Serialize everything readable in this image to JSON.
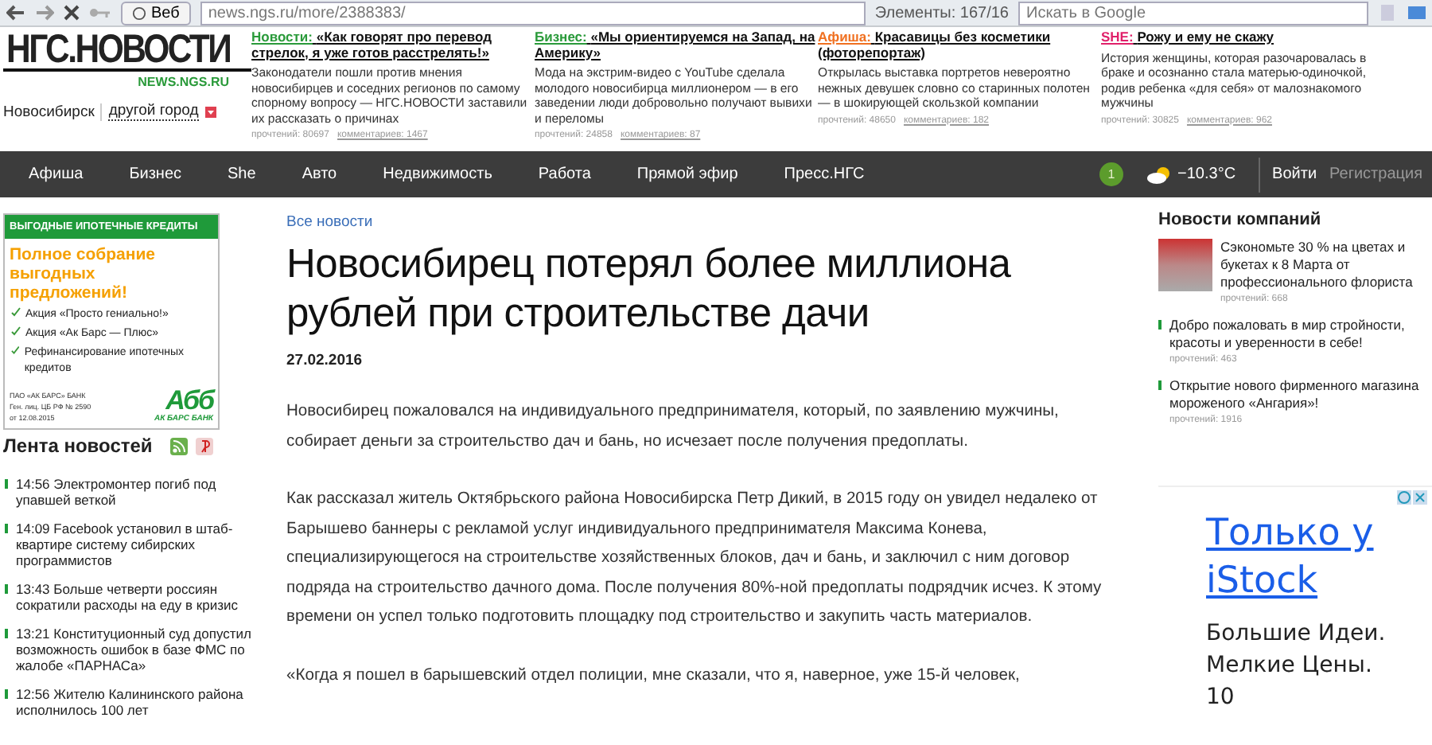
{
  "browser": {
    "tab_label": "Веб",
    "url": "news.ngs.ru/more/2388383/",
    "elements": "Элементы:  167/16",
    "search": {
      "placeholder": "Искать в Google"
    }
  },
  "header": {
    "logo": "НГС.НОВОСТИ",
    "domain": "NEWS.NGS.RU",
    "city": "Новосибирск",
    "other_city": "другой город",
    "teasers": [
      {
        "category": "Новости:",
        "color": "#2a9a3a",
        "title": "«Как говорят про перевод стрелок, я уже готов расстрелять!»",
        "text": "Законодатели пошли против мнения новосибирцев и соседних регионов по самому спорному вопросу — НГС.НОВОСТИ заставили их рассказать о причинах",
        "reads": "прочтений: 80697",
        "comments": "комментариев: 1467"
      },
      {
        "category": "Бизнес:",
        "color": "#2a9a3a",
        "title": "«Мы ориентируемся на Запад, на Америку»",
        "text": "Мода на экстрим-видео с YouTube сделала молодого новосибирца миллионером — в его заведении люди добровольно получают вывихи и переломы",
        "reads": "прочтений: 24858",
        "comments": "комментариев: 87"
      },
      {
        "category": "Афиша:",
        "color": "#f07020",
        "title": "Красавицы без косметики (фоторепортаж)",
        "text": "Открылась выставка портретов невероятно нежных девушек словно со старинных полотен — в шокирующей скользкой компании",
        "reads": "прочтений: 48650",
        "comments": "комментариев: 182"
      },
      {
        "category": "SHE:",
        "color": "#e0206a",
        "title": "Рожу и ему не скажу",
        "text": "История женщины, которая разочаровалась в браке и осознанно стала матерью-одиночкой, родив ребенка «для себя» от малознакомого мужчины",
        "reads": "прочтений: 30825",
        "comments": "комментариев: 962"
      }
    ]
  },
  "nav": {
    "items": [
      "Афиша",
      "Бизнес",
      "She",
      "Авто",
      "Недвижимость",
      "Работа",
      "Прямой эфир",
      "Пресс.НГС"
    ],
    "badge": "1",
    "weather": "−10.3°C",
    "login": "Войти",
    "register": "Регистрация"
  },
  "ad": {
    "header": "ВЫГОДНЫЕ ИПОТЕЧНЫЕ КРЕДИТЫ",
    "title": "Полное собрание выгодных предложений!",
    "items": [
      "Акция «Просто гениально!»",
      "Акция «Ак Барс — Плюс»",
      "Рефинансирование ипотечных кредитов"
    ],
    "legal": [
      "ПАО «АК БАРС» БАНК",
      "Ген. лиц. ЦБ РФ № 2590",
      "от 12.08.2015"
    ],
    "logo": "Абб",
    "bank": "АК БАРС БАНК"
  },
  "feed": {
    "title": "Лента новостей",
    "items": [
      {
        "time": "14:56",
        "text": "Электромонтер погиб под упавшей веткой"
      },
      {
        "time": "14:09",
        "text": "Facebook установил в штаб-квартире систему сибирских программистов"
      },
      {
        "time": "13:43",
        "text": "Больше четверти россиян сократили расходы на еду в кризис"
      },
      {
        "time": "13:21",
        "text": "Конституционный суд допустил возможность ошибок в базе ФМС по жалобе «ПАРНАСа»"
      },
      {
        "time": "12:56",
        "text": "Жителю Калининского района исполнилось 100 лет"
      }
    ]
  },
  "article": {
    "section": "Все новости",
    "title": "Новосибирец потерял более миллиона рублей при строительстве дачи",
    "date": "27.02.2016",
    "paragraphs": [
      "Новосибирец пожаловался на индивидуального предпринимателя, который, по заявлению мужчины, собирает деньги за строительство дач и бань, но исчезает после получения предоплаты.",
      "Как рассказал житель Октябрьского района Новосибирска Петр Дикий, в 2015 году он увидел недалеко от Барышево баннеры с рекламой услуг индивидуального предпринимателя Максима Конева, специализирующегося на строительстве хозяйственных блоков, дач и бань, и заключил с ним договор подряда на строительство дачного дома. После получения 80%-ной предоплаты подрядчик исчез. К этому времени он успел только подготовить площадку под строительство и закупить часть материалов.",
      "«Когда я пошел в барышевский отдел полиции, мне сказали, что я, наверное, уже 15-й человек,"
    ]
  },
  "companies": {
    "title": "Новости компаний",
    "items": [
      {
        "kind": "photo",
        "title": "Сэкономьте 30 % на цветах и букетах к 8 Марта от профессионального флориста",
        "reads": "прочтений: 668"
      },
      {
        "kind": "bullet",
        "title": "Добро пожаловать в мир стройности, красоты и уверенности в себе!",
        "reads": "прочтений: 463"
      },
      {
        "kind": "bullet",
        "title": "Открытие нового фирменного магазина мороженого «Ангария»!",
        "reads": "прочтений: 1916"
      }
    ]
  },
  "promo": {
    "link": "Только у iStock",
    "text": "Большие Идеи. Мелкие Цены. 10"
  }
}
